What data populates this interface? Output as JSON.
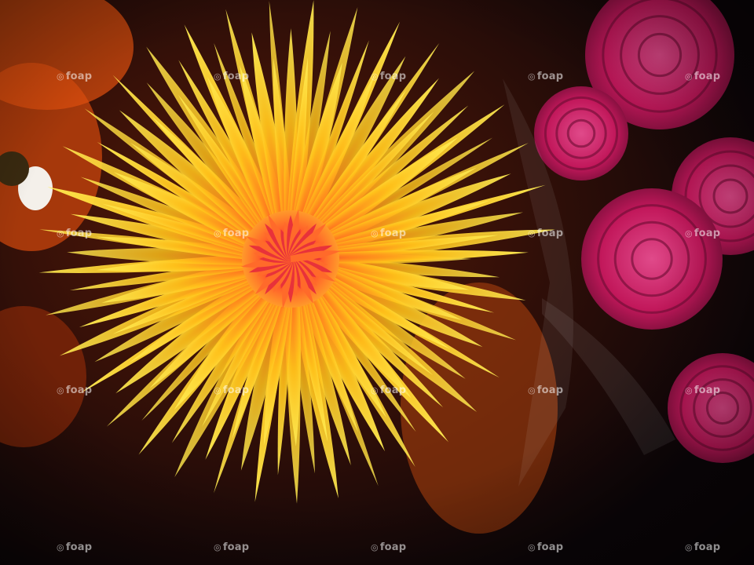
{
  "photo": {
    "subject": "yellow-orange spider chrysanthemum beside pink roses",
    "colors": {
      "petal_yellow": "#ffe21a",
      "petal_orange": "#ff7a1e",
      "center_red": "#e0323a",
      "rose_pink": "#c2185b",
      "rose_dark": "#7a0f3a",
      "background": "#0b0508"
    }
  },
  "watermark": {
    "text": "foap",
    "grid_rows": 4,
    "grid_cols": 5
  }
}
